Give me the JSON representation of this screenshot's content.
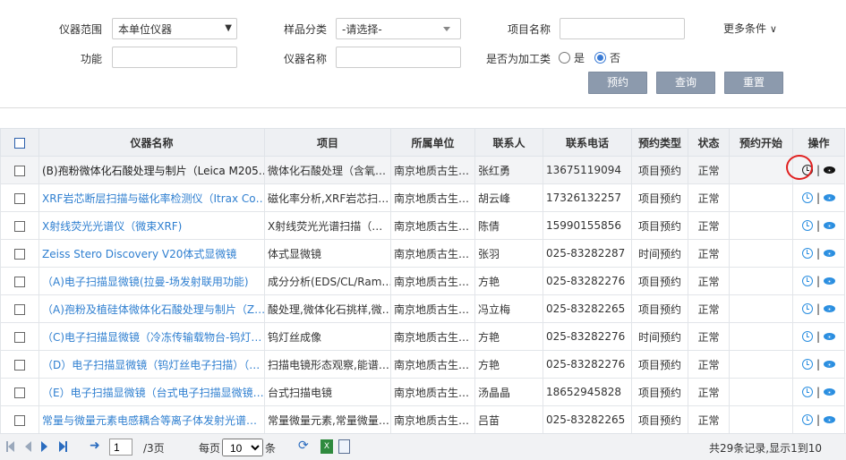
{
  "filters": {
    "instrument_scope_label": "仪器范围",
    "instrument_scope_value": "本单位仪器",
    "sample_category_label": "样品分类",
    "sample_category_value": "-请选择-",
    "project_name_label": "项目名称",
    "project_name_value": "",
    "more_conditions": "更多条件",
    "function_label": "功能",
    "function_value": "",
    "instrument_name_label": "仪器名称",
    "instrument_name_value": "",
    "processing_label": "是否为加工类",
    "yes_label": "是",
    "no_label": "否",
    "selected": "否",
    "reserve_button": "预约",
    "query_button": "查询",
    "reset_button": "重置"
  },
  "table": {
    "headers": [
      "仪器名称",
      "项目",
      "所属单位",
      "联系人",
      "联系电话",
      "预约类型",
      "状态",
      "预约开始",
      "操作"
    ],
    "rows": [
      {
        "name": "(B)孢粉微体化石酸处理与制片（Leica M205…",
        "project": "微体化石酸处理（含氧…",
        "unit": "南京地质古生…",
        "contact": "张红勇",
        "phone": "13675119094",
        "type": "项目预约",
        "status": "正常",
        "start": "",
        "highlighted": true
      },
      {
        "name": "XRF岩芯断层扫描与磁化率检测仪（Itrax Co…",
        "project": "磁化率分析,XRF岩芯扫…",
        "unit": "南京地质古生…",
        "contact": "胡云峰",
        "phone": "17326132257",
        "type": "项目预约",
        "status": "正常",
        "start": ""
      },
      {
        "name": "X射线荧光光谱仪（微束XRF)",
        "project": "X射线荧光光谱扫描（…",
        "unit": "南京地质古生…",
        "contact": "陈倩",
        "phone": "15990155856",
        "type": "项目预约",
        "status": "正常",
        "start": ""
      },
      {
        "name": "Zeiss Stero Discovery V20体式显微镜",
        "project": "体式显微镜",
        "unit": "南京地质古生…",
        "contact": "张羽",
        "phone": "025-83282287",
        "type": "时间预约",
        "status": "正常",
        "start": ""
      },
      {
        "name": "（A)电子扫描显微镜(拉曼-场发射联用功能)",
        "project": "成分分析(EDS/CL/Ram…",
        "unit": "南京地质古生…",
        "contact": "方艳",
        "phone": "025-83282276",
        "type": "项目预约",
        "status": "正常",
        "start": ""
      },
      {
        "name": "（A)孢粉及植硅体微体化石酸处理与制片（Z…",
        "project": "酸处理,微体化石挑样,微…",
        "unit": "南京地质古生…",
        "contact": "冯立梅",
        "phone": "025-83282265",
        "type": "项目预约",
        "status": "正常",
        "start": ""
      },
      {
        "name": "（C)电子扫描显微镜（冷冻传输载物台-钨灯…",
        "project": "钨灯丝成像",
        "unit": "南京地质古生…",
        "contact": "方艳",
        "phone": "025-83282276",
        "type": "时间预约",
        "status": "正常",
        "start": ""
      },
      {
        "name": "（D）电子扫描显微镜（钨灯丝电子扫描）（…",
        "project": "扫描电镜形态观察,能谱…",
        "unit": "南京地质古生…",
        "contact": "方艳",
        "phone": "025-83282276",
        "type": "项目预约",
        "status": "正常",
        "start": ""
      },
      {
        "name": "（E）电子扫描显微镜（台式电子扫描显微镜…",
        "project": "台式扫描电镜",
        "unit": "南京地质古生…",
        "contact": "汤晶晶",
        "phone": "18652945828",
        "type": "项目预约",
        "status": "正常",
        "start": ""
      },
      {
        "name": "常量与微量元素电感耦合等离子体发射光谱…",
        "project": "常量微量元素,常量微量…",
        "unit": "南京地质古生…",
        "contact": "吕苗",
        "phone": "025-83282265",
        "type": "项目预约",
        "status": "正常",
        "start": ""
      }
    ]
  },
  "pager": {
    "current_page": "1",
    "total_pages": "/3页",
    "per_page_label": "每页",
    "per_page_value": "10",
    "per_page_unit": "条",
    "summary": "共29条记录,显示1到10"
  },
  "colors": {
    "link": "#2f7fd0",
    "button": "#8c9aad",
    "highlight_ring": "#e02020"
  }
}
